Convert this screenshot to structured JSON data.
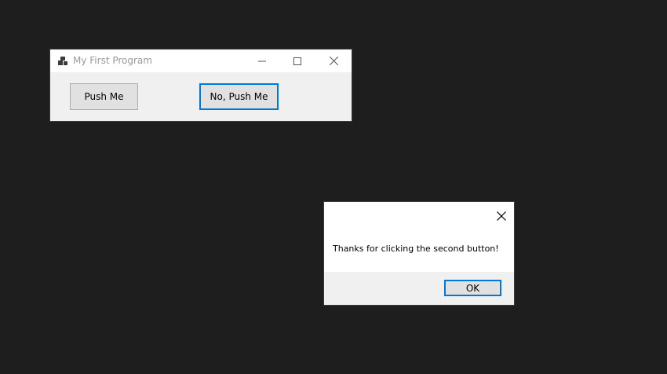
{
  "main_window": {
    "title": "My First Program",
    "buttons": {
      "push_me": "Push Me",
      "no_push_me": "No, Push Me"
    },
    "icons": {
      "app": "app-window-icon",
      "minimize": "minimize-icon",
      "maximize": "maximize-icon",
      "close": "close-icon"
    }
  },
  "message_box": {
    "text": "Thanks for clicking the second button!",
    "ok_label": "OK",
    "close_icon": "close-icon"
  },
  "colors": {
    "desktop": "#1e1e1e",
    "window_face": "#f0f0f0",
    "focus_border": "#0078d7",
    "button_face": "#e1e1e1",
    "button_border": "#adadad",
    "title_text": "#999999"
  }
}
